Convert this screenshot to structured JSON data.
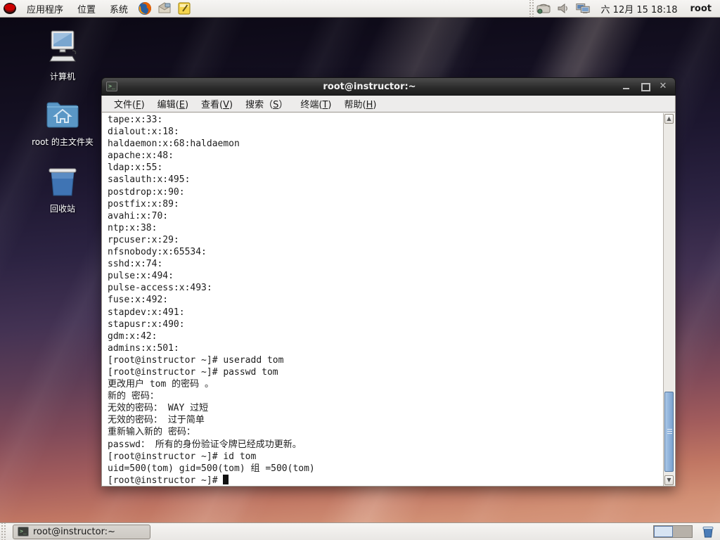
{
  "top_panel": {
    "menus": [
      {
        "label": "应用程序"
      },
      {
        "label": "位置"
      },
      {
        "label": "系统"
      }
    ],
    "launcher_icons": [
      "redhat-logo-icon",
      "firefox-icon",
      "email-icon",
      "text-editor-icon"
    ],
    "tray_icons": [
      "keyboard-icon",
      "volume-icon",
      "display-icon"
    ],
    "clock": "六 12月 15 18:18",
    "user": "root"
  },
  "desktop": {
    "icons": [
      {
        "label": "计算机"
      },
      {
        "label": "root 的主文件夹"
      },
      {
        "label": "回收站"
      }
    ]
  },
  "terminal": {
    "title": "root@instructor:~",
    "menu": [
      "文件(F)",
      "编辑(E)",
      "查看(V)",
      "搜索（S）",
      "终端(T)",
      "帮助(H)"
    ],
    "lines": [
      "tape:x:33:",
      "dialout:x:18:",
      "haldaemon:x:68:haldaemon",
      "apache:x:48:",
      "ldap:x:55:",
      "saslauth:x:495:",
      "postdrop:x:90:",
      "postfix:x:89:",
      "avahi:x:70:",
      "ntp:x:38:",
      "rpcuser:x:29:",
      "nfsnobody:x:65534:",
      "sshd:x:74:",
      "pulse:x:494:",
      "pulse-access:x:493:",
      "fuse:x:492:",
      "stapdev:x:491:",
      "stapusr:x:490:",
      "gdm:x:42:",
      "admins:x:501:",
      "[root@instructor ~]# useradd tom",
      "[root@instructor ~]# passwd tom",
      "更改用户 tom 的密码 。",
      "新的 密码：",
      "无效的密码： WAY 过短",
      "无效的密码： 过于简单",
      "重新输入新的 密码：",
      "passwd： 所有的身份验证令牌已经成功更新。",
      "[root@instructor ~]# id tom",
      "uid=500(tom) gid=500(tom) 组 =500(tom)"
    ],
    "prompt": "[root@instructor ~]# "
  },
  "taskbar": {
    "window_button": "root@instructor:~",
    "workspace_count": 2,
    "active_workspace": 1
  },
  "colors": {
    "panel_bg": "#edeceb",
    "titlebar_bg": "#2a2a2a",
    "terminal_bg": "#ffffff",
    "terminal_text": "#1c1c1c",
    "scrollbar_thumb": "#7aa2cf",
    "desktop_top": "#0b0814",
    "desktop_bottom": "#d99a80",
    "workspace_active": "#d7e4f3"
  }
}
